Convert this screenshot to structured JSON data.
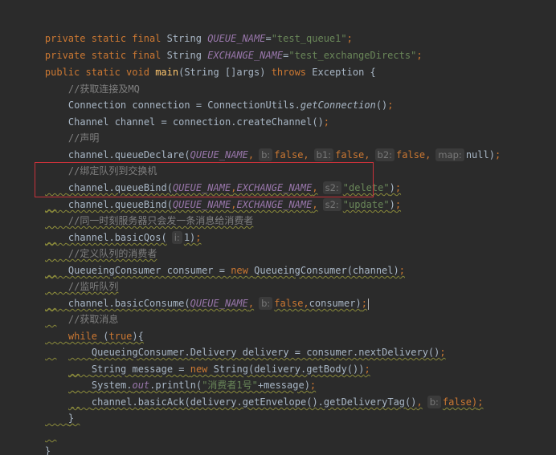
{
  "lines": [
    {
      "a": "private static final ",
      "b": "String ",
      "c": "QUEUE_NAME",
      "d": "=",
      "e": "\"test_queue1\"",
      "f": ";"
    },
    {
      "a": "private static final ",
      "b": "String ",
      "c": "EXCHANGE_NAME",
      "d": "=",
      "e": "\"test_exchangeDirects\"",
      "f": ";"
    },
    {
      "a": "public static void ",
      "b": "main",
      "c": "(String []args) ",
      "d": "throws ",
      "e": "Exception {"
    },
    {
      "a": "//获取连接及MQ"
    },
    {
      "a": "Connection connection = ConnectionUtils.",
      "b": "getConnection",
      "c": "()",
      "d": ";"
    },
    {
      "a": "Channel channel = connection.createChannel()",
      "b": ";"
    },
    {
      "a": "//声明"
    },
    {
      "a": "channel.queueDeclare(",
      "b": "QUEUE_NAME",
      "c": ",",
      "h1": "b:",
      "d": "false",
      "e": ",",
      "h2": "b1:",
      "f": "false",
      "g": ",",
      "h3": "b2:",
      "i": "false",
      "j": ",",
      "h4": "map:",
      "k": "null)",
      "l": ";"
    },
    {
      "a": "//绑定队列到交换机"
    },
    {
      "a": "channel.queueBind(",
      "b": "QUEUE_NAME",
      "c": ",",
      "d": "EXCHANGE_NAME",
      "e": ",",
      "h1": "s2:",
      "f": "\"delete\"",
      "g": ")",
      "h": ";"
    },
    {
      "a": "channel.queueBind(",
      "b": "QUEUE_NAME",
      "c": ",",
      "d": "EXCHANGE_NAME",
      "e": ",",
      "h1": "s2:",
      "f": "\"update\"",
      "g": ")",
      "h": ";"
    },
    {
      "a": "//同一时刻服务器只会发一条消息给消费者"
    },
    {
      "a": "channel.basicQos(",
      "h1": "i:",
      "b": "1)",
      "c": ";"
    },
    {
      "a": "//定义队列的消费者"
    },
    {
      "a": "QueueingConsumer consumer = ",
      "b": "new ",
      "c": "QueueingConsumer(channel)",
      "d": ";"
    },
    {
      "a": "//监听队列"
    },
    {
      "a": "channel.basicConsume(",
      "b": "QUEUE_NAME",
      "c": ",",
      "h1": "b:",
      "d": "false",
      "e": ",",
      "f": "consumer)",
      "g": ";"
    },
    {
      "a": "//获取消息"
    },
    {
      "a": "while ",
      "b": "(",
      "c": "true",
      "d": "){"
    },
    {
      "a": "QueueingConsumer.Delivery delivery = consumer.nextDelivery()",
      "b": ";"
    },
    {
      "a": "String message = ",
      "b": "new ",
      "c": "String(delivery.getBody())",
      "d": ";"
    },
    {
      "a": "System.",
      "b": "out",
      "c": ".println(",
      "d": "\"消费者1号\"",
      "e": "+message)",
      "f": ";"
    },
    {
      "a": "channel.basicAck(delivery.getEnvelope().getDeliveryTag()",
      "b": ",",
      "h1": "b:",
      "c": "false)",
      "d": ";"
    },
    {
      "a": "}"
    },
    {
      "a": "}"
    }
  ],
  "colors": {
    "background": "#2b2b2b",
    "keyword": "#cc7832",
    "method": "#ffc66d",
    "static_field": "#9876aa",
    "string": "#6a8759",
    "comment": "#808080",
    "text": "#a9b7c6",
    "highlight_box": "#c8323a"
  }
}
